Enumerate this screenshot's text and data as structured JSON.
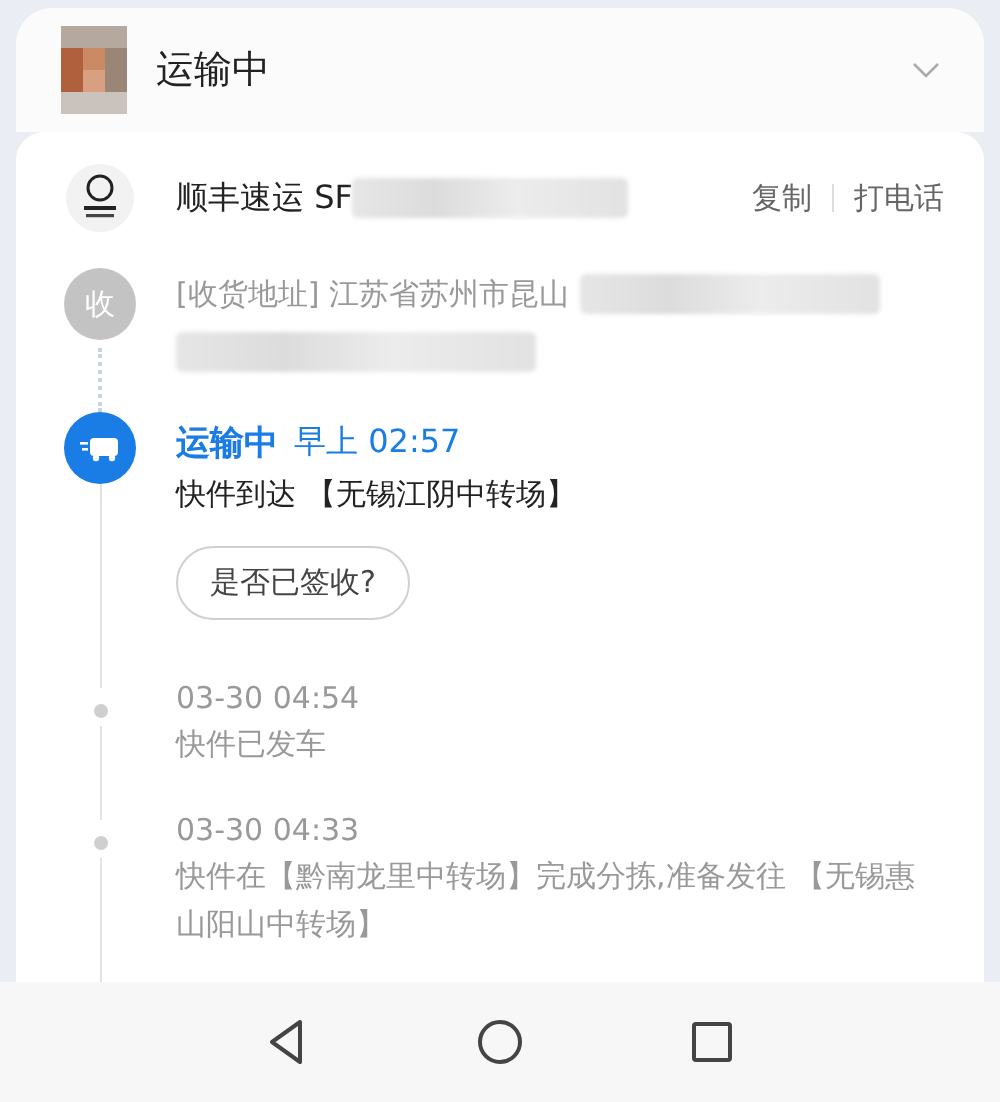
{
  "header": {
    "title": "运输中"
  },
  "parcel": {
    "carrier": "顺丰速运 SF",
    "actions": [
      "复制",
      "打电话"
    ]
  },
  "address": {
    "badge": "收",
    "text": "[收货地址] 江苏省苏州市昆山"
  },
  "events": [
    {
      "kind": "current",
      "status": "运输中",
      "time": "早上 02:57",
      "text": "快件到达 【无锡江阴中转场】",
      "button": "是否已签收?"
    },
    {
      "kind": "past",
      "time": "03-30 04:54",
      "text": "快件已发车"
    },
    {
      "kind": "past",
      "time": "03-30 04:33",
      "text": "快件在【黔南龙里中转场】完成分拣,准备发往 【无锡惠山阳山中转场】"
    }
  ]
}
